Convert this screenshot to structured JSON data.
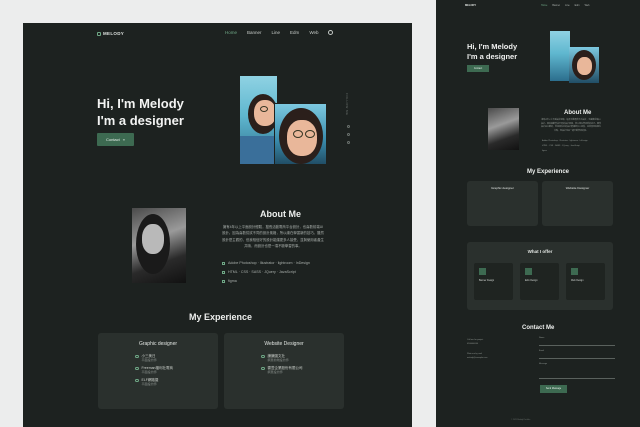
{
  "nav": {
    "brand": "MELODY",
    "items": [
      "Home",
      "Banner",
      "Line",
      "Edm",
      "Web"
    ]
  },
  "hero": {
    "line1": "Hi, I'm Melody",
    "line2": "I'm a designer",
    "contact_label": "Contact"
  },
  "side": {
    "follow": "FOLLOW ME"
  },
  "about": {
    "title": "About Me",
    "text": "擁有4年以上平面設計經驗，擅長活動電商平台設計，也喜歡前端UI設計。因為喜歡嘗試不同的設計風格，所以總在學習新的技巧。雖然設計是主觀的，但我相信好的設計能讓更多人接受，並與使用者產生共鳴，而設計也是一項不斷學習的事。",
    "skills": [
      "Adobe Photoshop · Illustrator · lightroom · InDesign",
      "HTML · CSS · SASS · JQuery · JavaScript",
      "figma"
    ]
  },
  "experience": {
    "title": "My Experience",
    "cards": [
      {
        "title": "Graphic designer",
        "items": [
          {
            "name": "小三美日",
            "period": "平面設計師"
          },
          {
            "name": "Freeman福利社電商",
            "period": "平面設計師"
          },
          {
            "name": "ELF網路攝",
            "period": "平面設計師"
          }
        ]
      },
      {
        "title": "Website Designer",
        "items": [
          {
            "name": "謙謙圖文社",
            "period": "網頁前端設計師"
          },
          {
            "name": "雲豐企業股份有限公司",
            "period": "網頁設計師"
          }
        ]
      }
    ]
  },
  "offer": {
    "title": "What I offer",
    "cards": [
      "Banner Design",
      "Edm Design",
      "Web Design"
    ]
  },
  "contact": {
    "title": "Contact Me",
    "phone_label": "Call me for project",
    "phone": "0900000000",
    "mail_label": "Write me by mail",
    "mail": "melody@example.com",
    "fields": [
      "Name",
      "Email",
      "Message"
    ],
    "send_label": "Send Message"
  },
  "footer": {
    "text": "© 2021 Melody Portfolio"
  },
  "colors": {
    "bg": "#1d2220",
    "card": "#2a302d",
    "accent": "#3d6a51",
    "accent_light": "#6fa886"
  }
}
